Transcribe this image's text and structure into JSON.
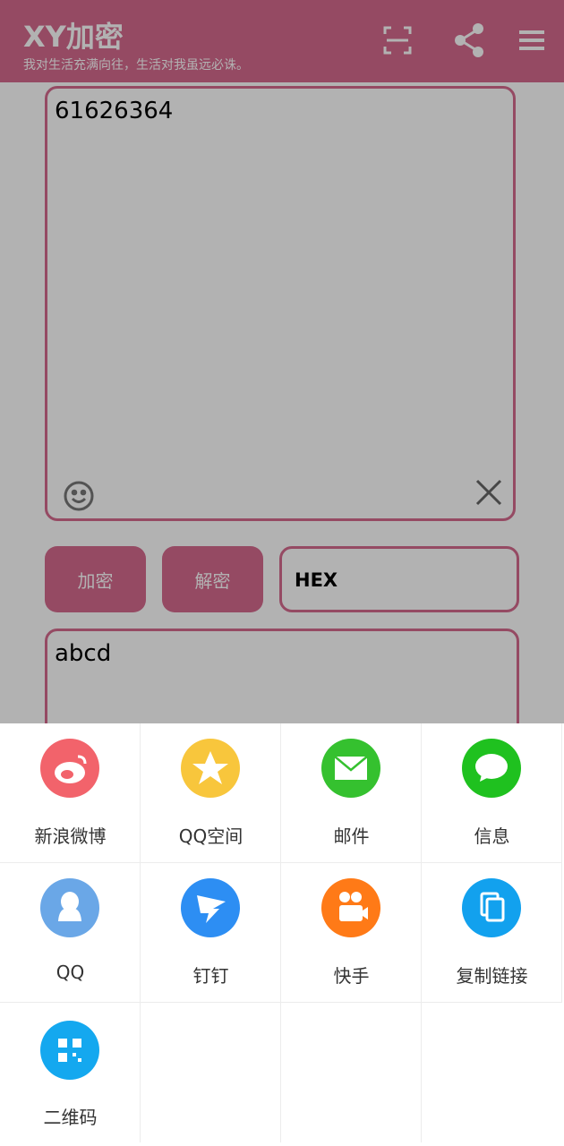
{
  "appbar": {
    "title": "XY加密",
    "subtitle": "我对生活充满向往，生活对我虽远必诛。",
    "icons": [
      "scan-icon",
      "share-icon",
      "menu-icon"
    ]
  },
  "editor": {
    "input_value": "61626364",
    "encrypt_label": "加密",
    "decrypt_label": "解密",
    "mode_value": "HEX",
    "output_value": "abcd"
  },
  "share_sheet": {
    "items": [
      {
        "label": "新浪微博",
        "icon": "weibo-icon",
        "color": "#f2636b"
      },
      {
        "label": "QQ空间",
        "icon": "qzone-icon",
        "color": "#f8c63c"
      },
      {
        "label": "邮件",
        "icon": "mail-icon",
        "color": "#35c12f"
      },
      {
        "label": "信息",
        "icon": "message-icon",
        "color": "#1fc11f"
      },
      {
        "label": "QQ",
        "icon": "qq-icon",
        "color": "#6aa7e7"
      },
      {
        "label": "钉钉",
        "icon": "dingtalk-icon",
        "color": "#2d8ef3"
      },
      {
        "label": "快手",
        "icon": "kuaishou-icon",
        "color": "#ff7a17"
      },
      {
        "label": "复制链接",
        "icon": "copy-link-icon",
        "color": "#12a1ee"
      },
      {
        "label": "二维码",
        "icon": "qrcode-icon",
        "color": "#14a8ef"
      }
    ]
  },
  "colors": {
    "accent": "#d66a8f",
    "scrim": "rgba(0,0,0,0.3)"
  }
}
